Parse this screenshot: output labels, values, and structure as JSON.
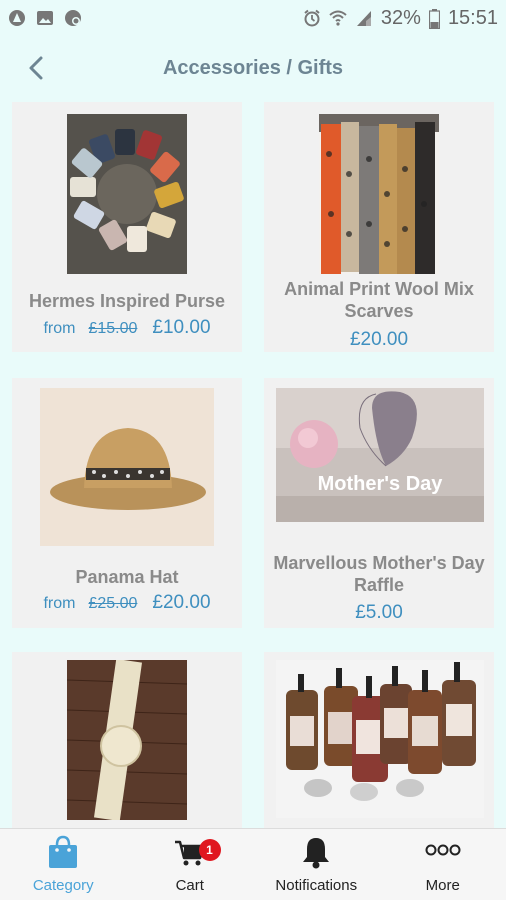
{
  "status_bar": {
    "battery_percent": "32%",
    "time": "15:51"
  },
  "header": {
    "title": "Accessories / Gifts"
  },
  "products": [
    {
      "name": "Hermes Inspired Purse",
      "from": "from",
      "old_price": "£15.00",
      "price": "£10.00"
    },
    {
      "name": "Animal Print Wool Mix Scarves",
      "price": "£20.00"
    },
    {
      "name": "Panama Hat",
      "from": "from",
      "old_price": "£25.00",
      "price": "£20.00"
    },
    {
      "name": "Marvellous Mother's Day Raffle",
      "price": "£5.00",
      "image_caption": "Mother's Day"
    },
    {
      "name": "",
      "price": ""
    },
    {
      "name": "",
      "price": ""
    }
  ],
  "tabs": [
    {
      "label": "Category",
      "icon": "shopping-bag-icon",
      "active": true
    },
    {
      "label": "Cart",
      "icon": "cart-icon",
      "badge": "1"
    },
    {
      "label": "Notifications",
      "icon": "bell-icon"
    },
    {
      "label": "More",
      "icon": "more-dots-icon"
    }
  ],
  "colors": {
    "background": "#e9fbfa",
    "accent": "#4aa3d8",
    "price": "#3f8fbf",
    "badge": "#e0171f"
  }
}
